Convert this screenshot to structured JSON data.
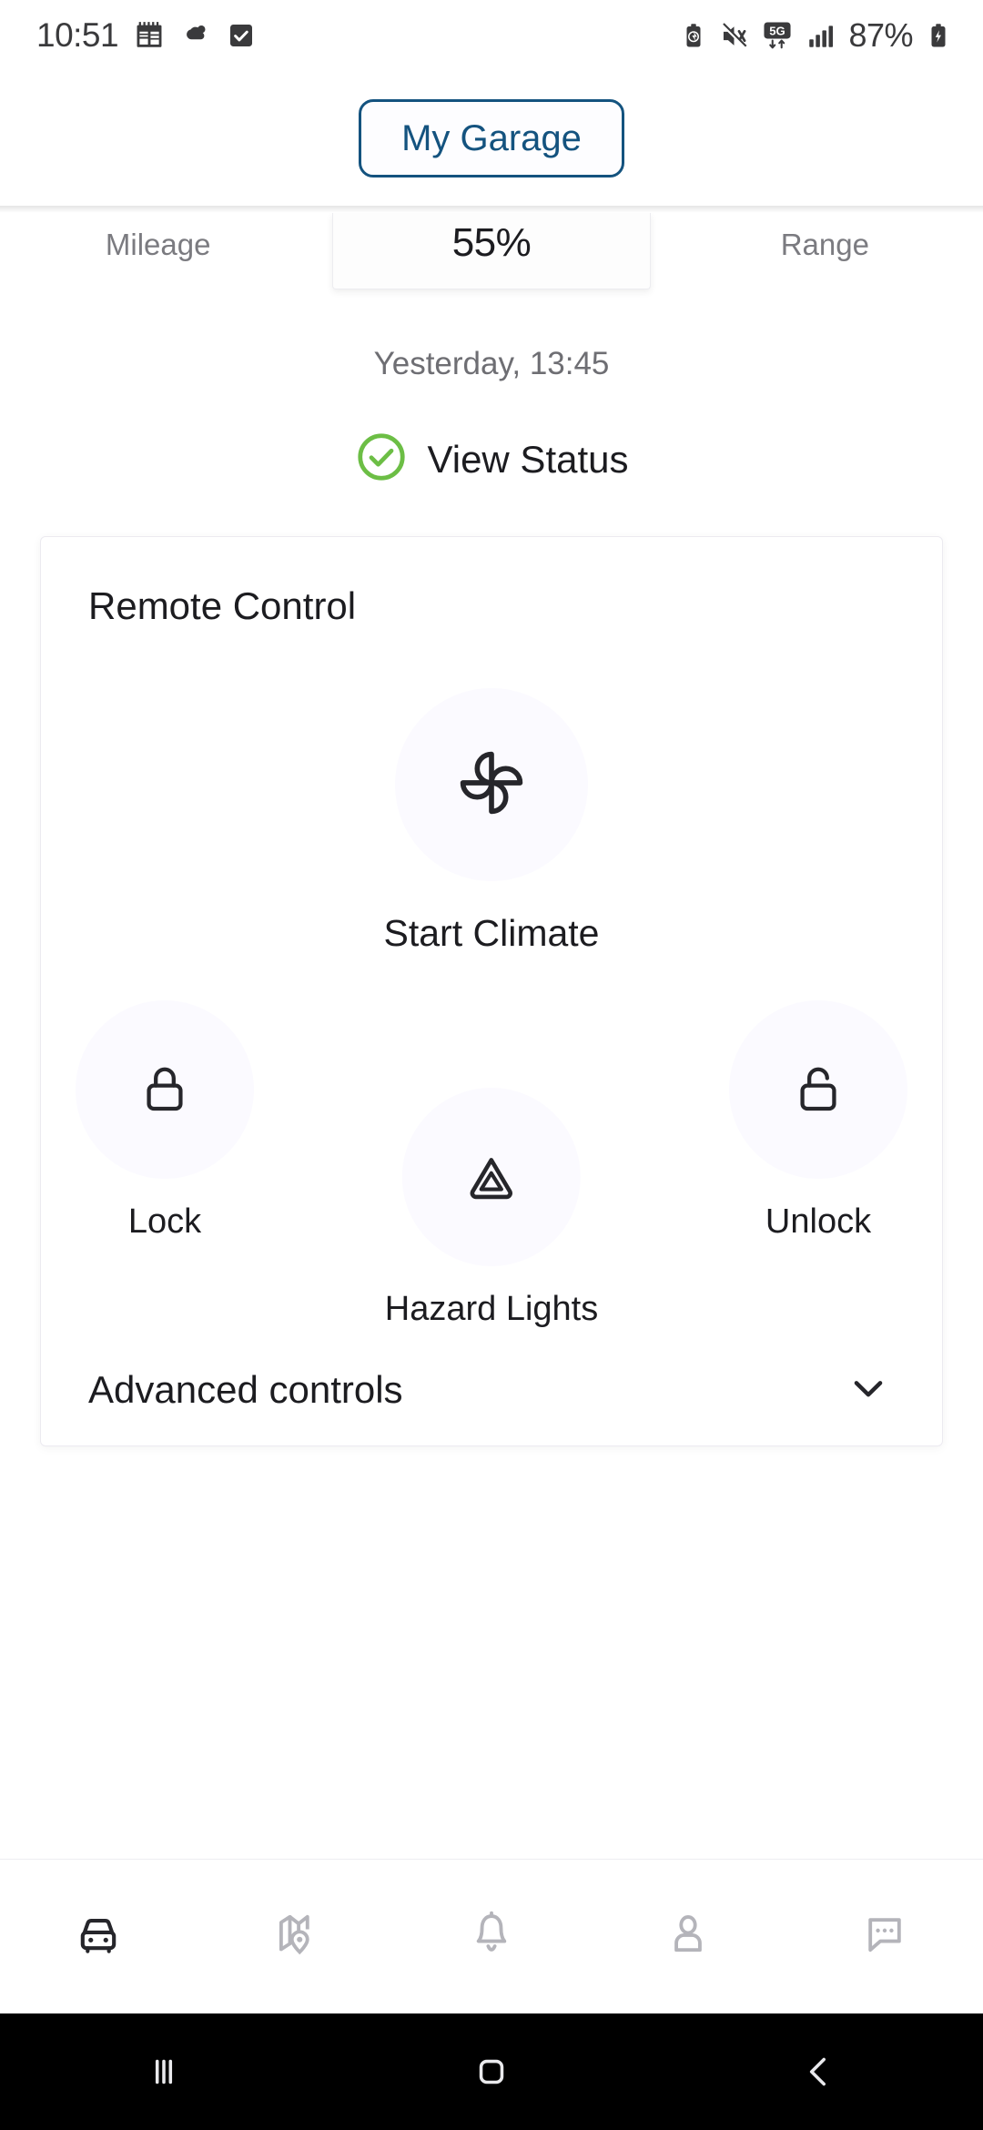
{
  "status_bar": {
    "time": "10:51",
    "battery_percent": "87%",
    "left_icons": [
      "calendar-icon",
      "weather-cloud-icon",
      "checkbox-check-icon"
    ],
    "right_icons": [
      "battery-saver-icon",
      "mute-vibrate-icon",
      "5g-network-icon",
      "signal-bars-icon",
      "battery-charging-icon"
    ],
    "network_label": "5G"
  },
  "app_bar": {
    "garage_button": "My Garage"
  },
  "metrics": {
    "left_label": "Mileage",
    "center_value": "55%",
    "right_label": "Range"
  },
  "vehicle_status": {
    "timestamp": "Yesterday, 13:45",
    "view_status_label": "View Status",
    "status_icon_color": "#6cbe45"
  },
  "remote_control": {
    "title": "Remote Control",
    "primary": {
      "label": "Start Climate",
      "icon": "pinwheel-fan-icon"
    },
    "actions": [
      {
        "label": "Lock",
        "icon": "lock-closed-icon"
      },
      {
        "label": "Hazard Lights",
        "icon": "hazard-triangle-icon"
      },
      {
        "label": "Unlock",
        "icon": "lock-open-icon"
      }
    ],
    "advanced": {
      "label": "Advanced controls",
      "icon": "chevron-down-icon"
    }
  },
  "bottom_nav": {
    "items": [
      {
        "name": "vehicle",
        "icon": "car-front-icon",
        "active": true
      },
      {
        "name": "map",
        "icon": "map-pin-icon",
        "active": false
      },
      {
        "name": "notifications",
        "icon": "bell-icon",
        "active": false
      },
      {
        "name": "profile",
        "icon": "person-icon",
        "active": false
      },
      {
        "name": "messages",
        "icon": "chat-bubble-icon",
        "active": false
      }
    ],
    "active_color": "#26262b",
    "inactive_color": "#b4b4ba"
  },
  "system_nav": {
    "buttons": [
      "recents-icon",
      "home-icon",
      "back-icon"
    ]
  },
  "theme": {
    "accent_blue": "#14537f",
    "ink": "#1c1c20",
    "muted": "#7b7b80",
    "circle_bg": "#fbfaff"
  }
}
